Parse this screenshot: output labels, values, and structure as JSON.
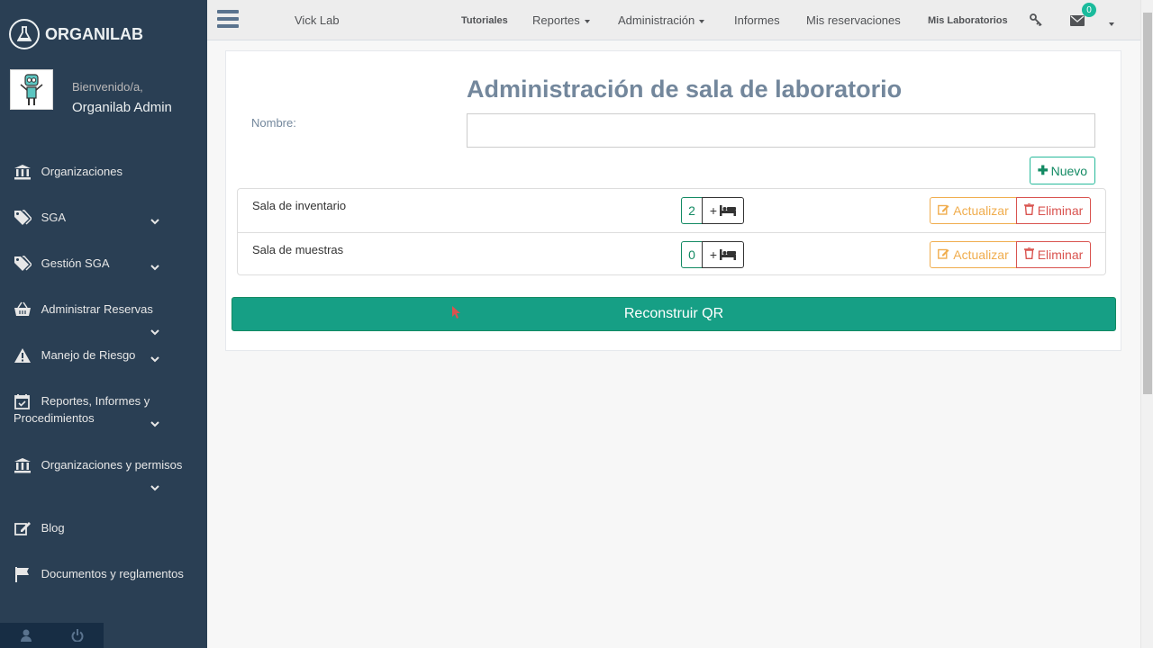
{
  "sidebar": {
    "brand": "ORGANILAB",
    "welcome": "Bienvenido/a,",
    "username": "Organilab Admin",
    "items": [
      {
        "label": "Organizaciones",
        "icon": "bank-icon",
        "has_chevron": false
      },
      {
        "label": "SGA",
        "icon": "tags-icon",
        "has_chevron": true
      },
      {
        "label": "Gestión SGA",
        "icon": "tags-icon",
        "has_chevron": true
      },
      {
        "label": "Administrar Reservas",
        "icon": "basket-icon",
        "has_chevron": true
      },
      {
        "label": "Manejo de Riesgo",
        "icon": "warning-icon",
        "has_chevron": true
      },
      {
        "label": "Reportes, Informes y Procedimientos",
        "icon": "calendar-check-icon",
        "has_chevron": true
      },
      {
        "label": "Organizaciones y permisos",
        "icon": "bank-icon",
        "has_chevron": true
      },
      {
        "label": "Blog",
        "icon": "edit-icon",
        "has_chevron": false
      },
      {
        "label": "Documentos y reglamentos",
        "icon": "flag-icon",
        "has_chevron": false
      }
    ],
    "footer_icons": [
      "user-icon",
      "power-icon"
    ]
  },
  "topnav": {
    "lab_name": "Vick Lab",
    "tutorials": "Tutoriales",
    "reports": "Reportes",
    "administration": "Administración",
    "informs": "Informes",
    "reservations": "Mis reservaciones",
    "my_labs": "Mis Laboratorios",
    "messages_count": "0"
  },
  "main": {
    "title": "Administración de sala de laboratorio",
    "name_label": "Nombre:",
    "name_value": "",
    "new_button": "Nuevo",
    "rooms": [
      {
        "name": "Sala de inventario",
        "count": "2",
        "add_label": "+"
      },
      {
        "name": "Sala de muestras",
        "count": "0",
        "add_label": "+"
      }
    ],
    "update_label": "Actualizar",
    "delete_label": "Eliminar",
    "rebuild_qr": "Reconstruir QR"
  },
  "colors": {
    "sidebar": "#2a3f54",
    "accent": "#169f85",
    "warning": "#f0ad4e",
    "danger": "#d9534f"
  }
}
